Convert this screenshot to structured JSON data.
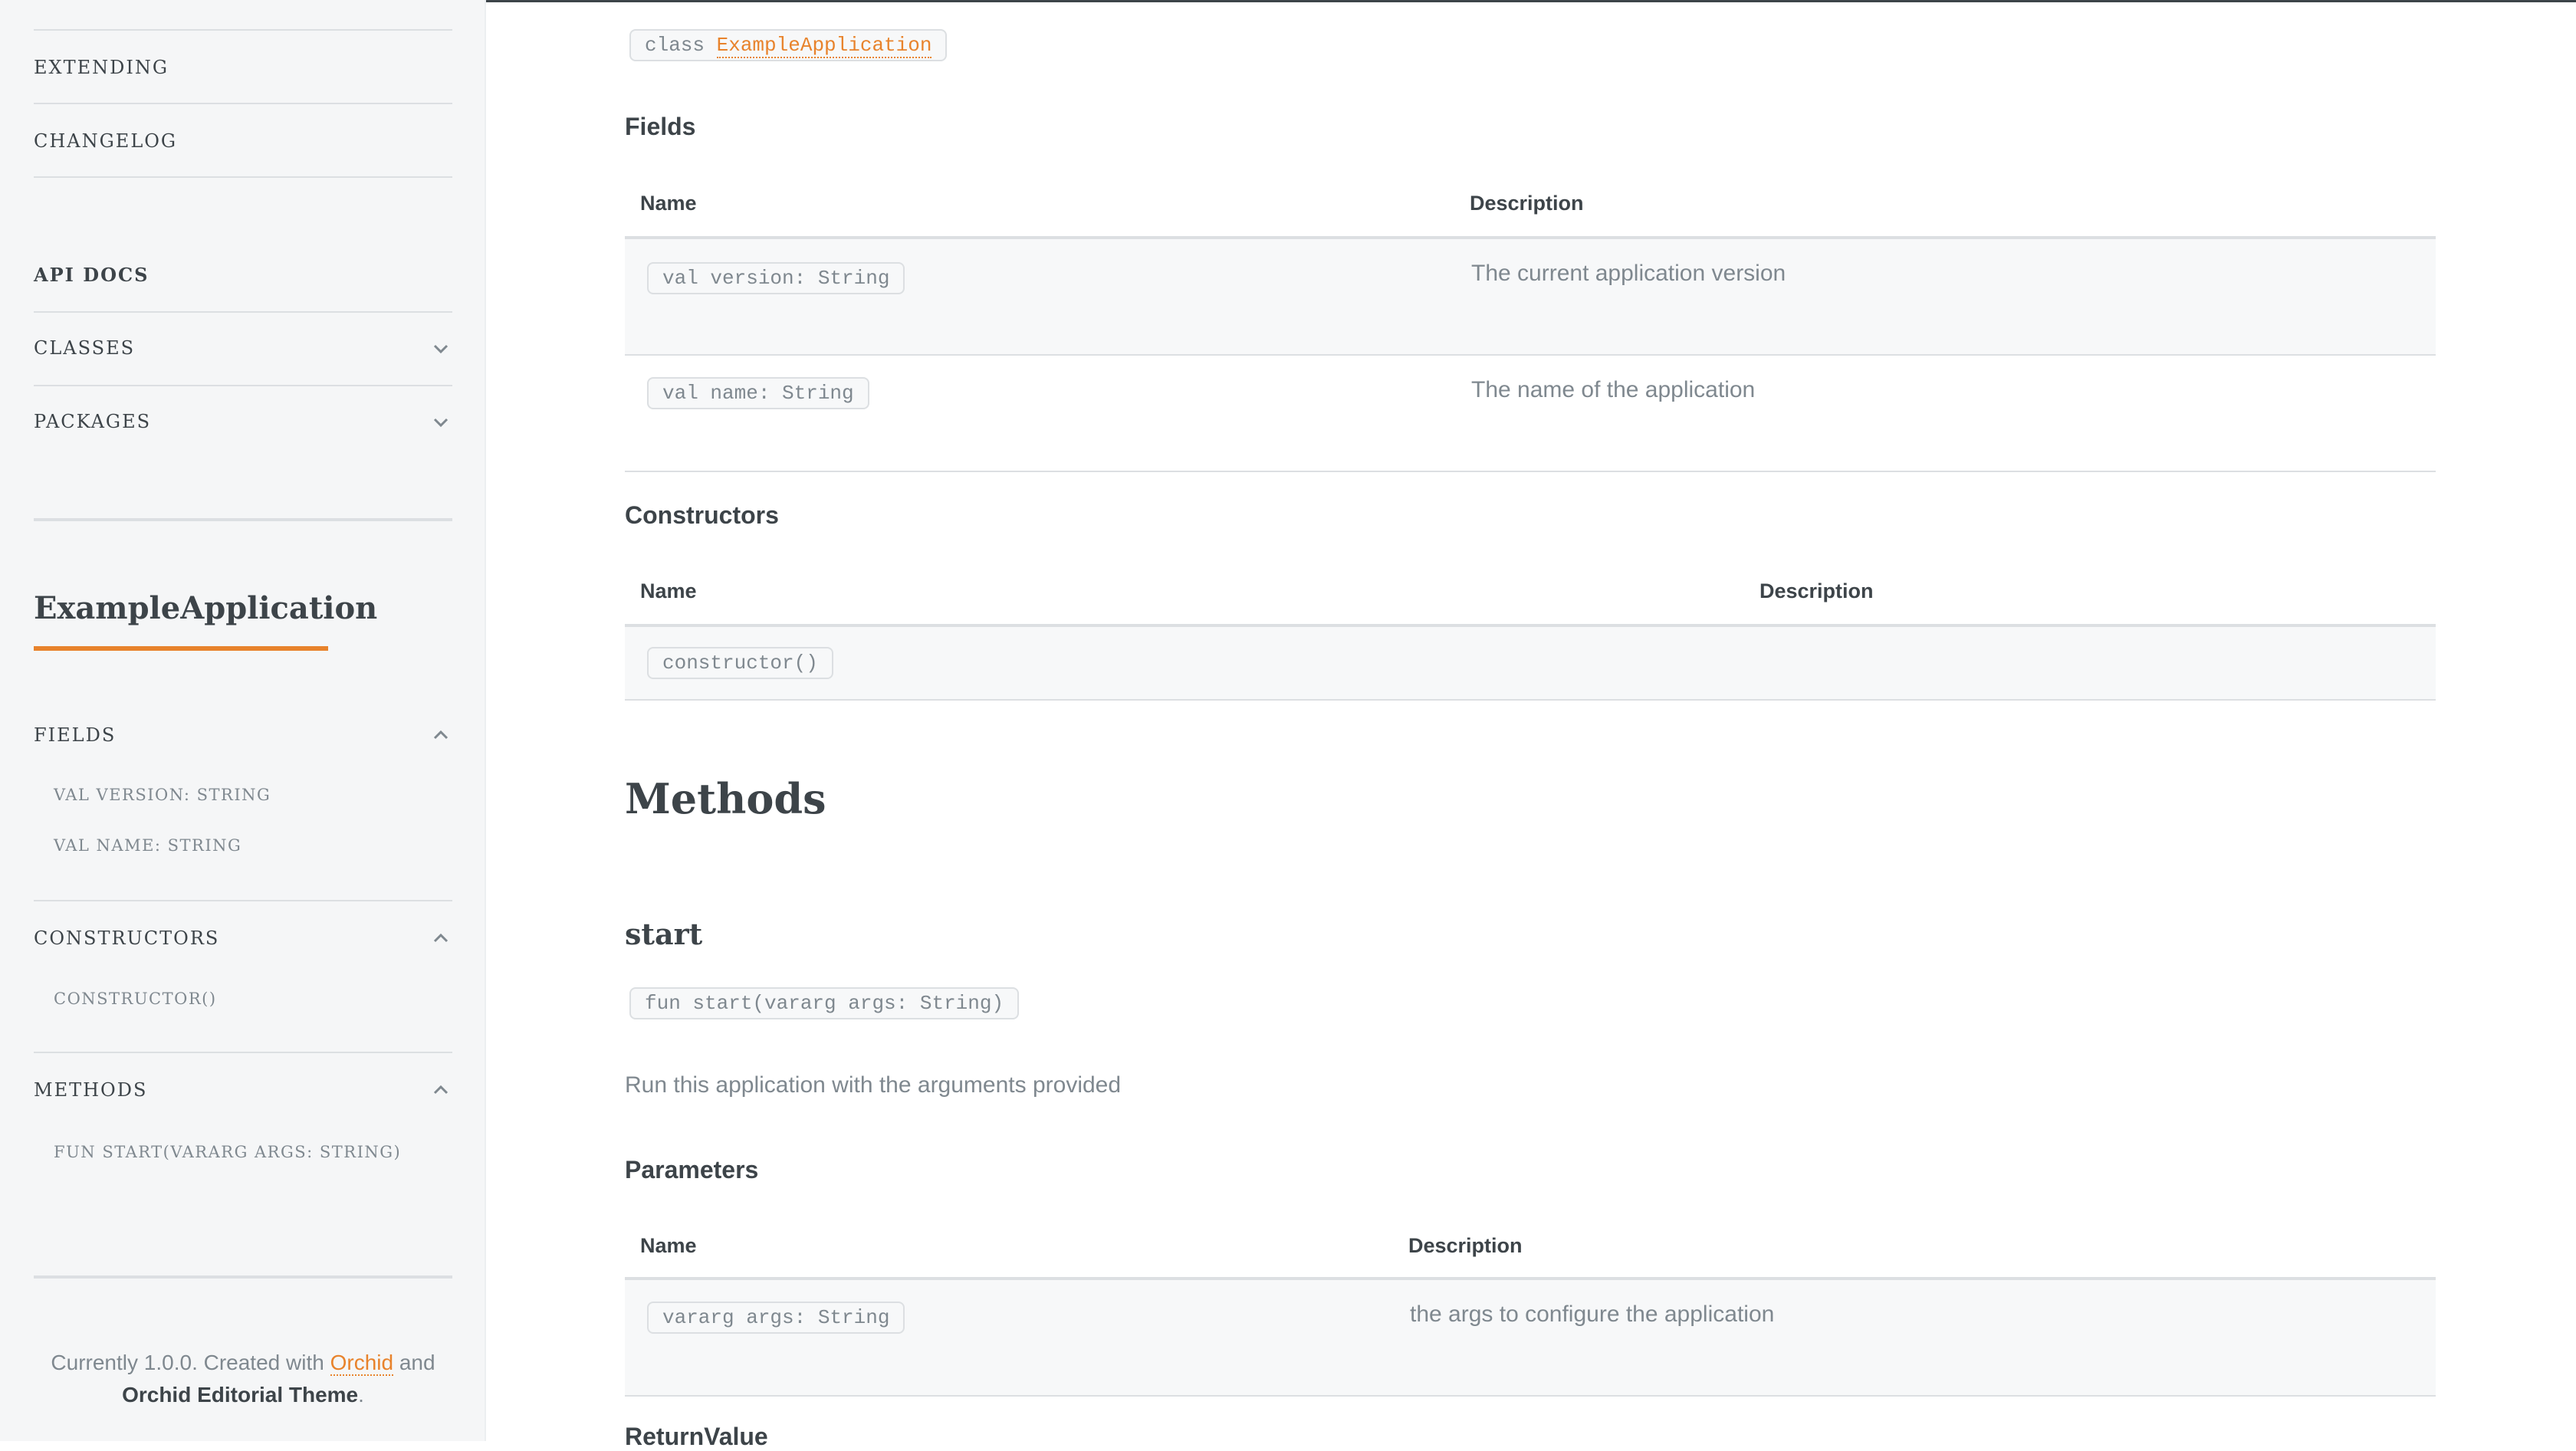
{
  "sidebar": {
    "nav_items": [
      "EXTENDING",
      "CHANGELOG"
    ],
    "api_docs_heading": "API DOCS",
    "api_sections": [
      "CLASSES",
      "PACKAGES"
    ],
    "title": "ExampleApplication",
    "fields_section": {
      "label": "FIELDS",
      "items": [
        "VAL VERSION: STRING",
        "VAL NAME: STRING"
      ]
    },
    "constructors_section": {
      "label": "CONSTRUCTORS",
      "items": [
        "CONSTRUCTOR()"
      ]
    },
    "methods_section": {
      "label": "METHODS",
      "items": [
        "FUN START(VARARG ARGS: STRING)"
      ]
    },
    "footer": {
      "prefix": "Currently 1.0.0. Created with ",
      "orchid_link": "Orchid",
      "middle": " and",
      "theme": "Orchid Editorial Theme",
      "suffix": "."
    }
  },
  "main": {
    "class_signature": {
      "keyword": "class",
      "name": "ExampleApplication"
    },
    "fields": {
      "heading": "Fields",
      "col_name": "Name",
      "col_description": "Description",
      "rows": [
        {
          "name": "val version: String",
          "description": "The current application version"
        },
        {
          "name": "val name: String",
          "description": "The name of the application"
        }
      ]
    },
    "constructors": {
      "heading": "Constructors",
      "col_name": "Name",
      "col_description": "Description",
      "rows": [
        {
          "name": "constructor()",
          "description": ""
        }
      ]
    },
    "methods_heading": "Methods",
    "method": {
      "name": "start",
      "signature": "fun start(vararg args: String)",
      "description": "Run this application with the arguments provided",
      "parameters": {
        "heading": "Parameters",
        "col_name": "Name",
        "col_description": "Description",
        "rows": [
          {
            "name": "vararg args: String",
            "description": "the args to configure the application"
          }
        ]
      },
      "return_heading": "ReturnValue"
    }
  },
  "colors": {
    "accent": "#e8832c",
    "text": "#3d4449",
    "muted": "#7f888f",
    "sidebar_bg": "#f5f6f7"
  }
}
